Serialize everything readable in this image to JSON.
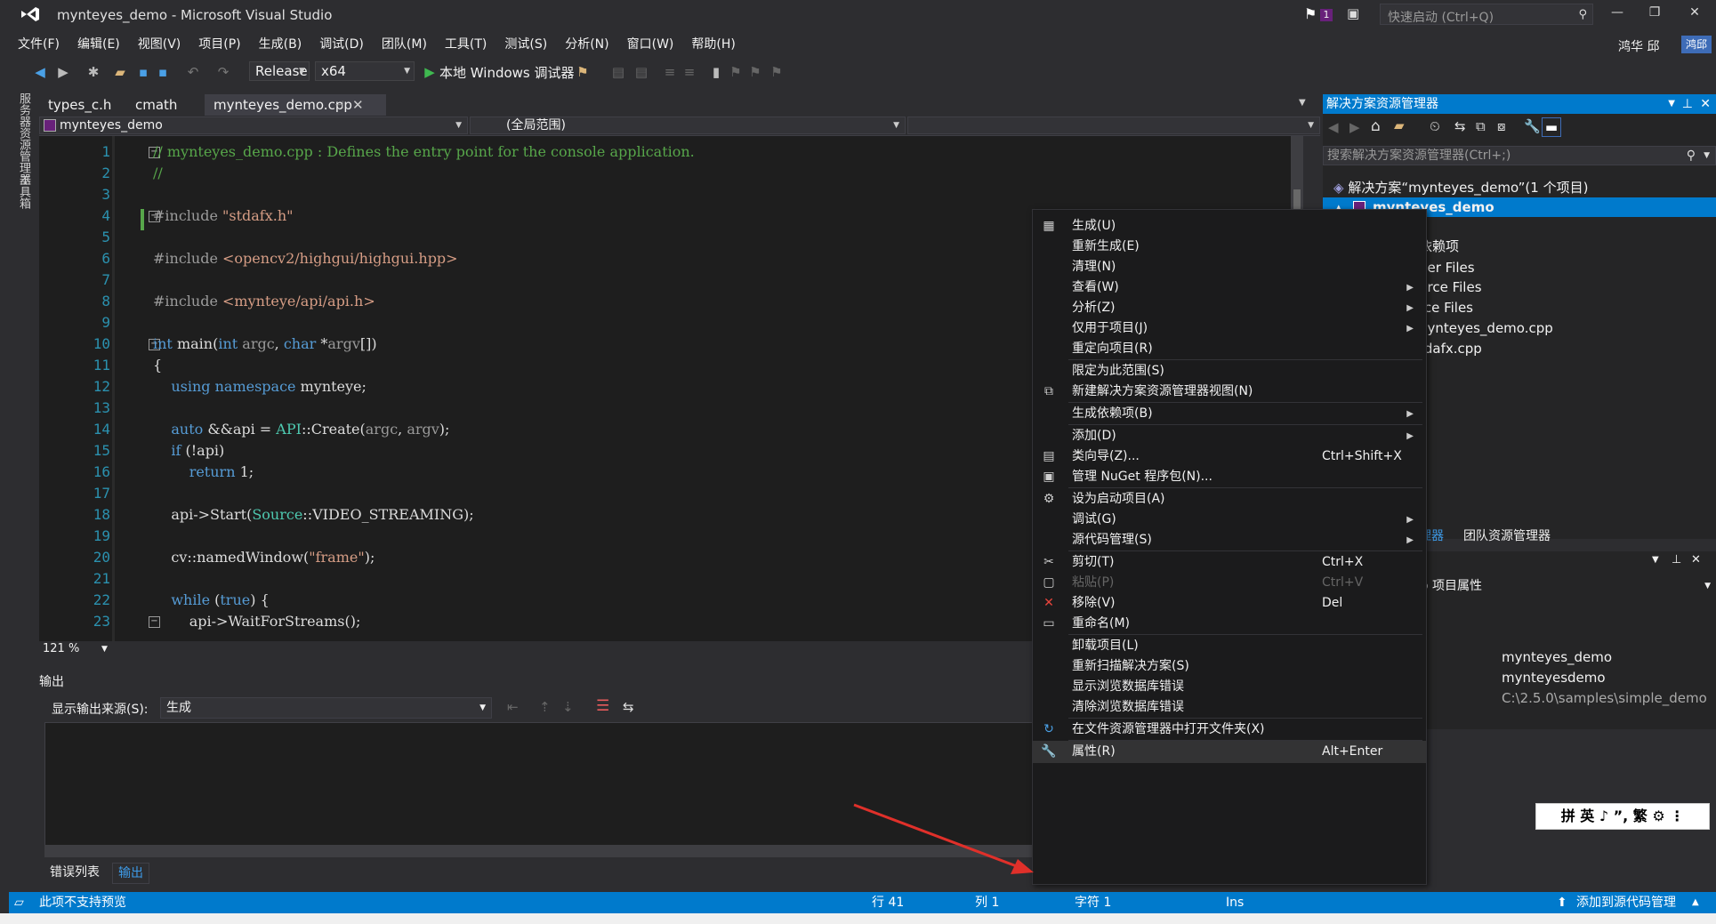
{
  "window": {
    "title": "mynteyes_demo - Microsoft Visual Studio",
    "notification_count": "1",
    "quick_launch_placeholder": "快速启动 (Ctrl+Q)",
    "user_name": "鸿华 邱",
    "user_chip": "鸿邱"
  },
  "menu": [
    "文件(F)",
    "编辑(E)",
    "视图(V)",
    "项目(P)",
    "生成(B)",
    "调试(D)",
    "团队(M)",
    "工具(T)",
    "测试(S)",
    "分析(N)",
    "窗口(W)",
    "帮助(H)"
  ],
  "toolbar": {
    "configuration": "Release",
    "platform": "x64",
    "debugger": "本地 Windows 调试器"
  },
  "left_tabs": [
    "服务器资源管理器",
    "工具箱"
  ],
  "doc_tabs": [
    "types_c.h",
    "cmath",
    "mynteyes_demo.cpp"
  ],
  "navbar": {
    "project": "mynteyes_demo",
    "scope": "(全局范围)"
  },
  "editor": {
    "line_numbers": [
      "1",
      "2",
      "3",
      "4",
      "5",
      "6",
      "7",
      "8",
      "9",
      "10",
      "11",
      "12",
      "13",
      "14",
      "15",
      "16",
      "17",
      "18",
      "19",
      "20",
      "21",
      "22",
      "23"
    ],
    "zoom": "121 %"
  },
  "output": {
    "title": "输出",
    "source_label": "显示输出来源(S):",
    "source_value": "生成",
    "tabs": [
      "错误列表",
      "输出"
    ]
  },
  "solution_explorer": {
    "title": "解决方案资源管理器",
    "search_placeholder": "搜索解决方案资源管理器(Ctrl+;)",
    "solution_label": "解决方案“mynteyes_demo”(1 个项目)",
    "project_label": "mynteyes_demo",
    "items": [
      "依赖项",
      "der Files",
      "urce Files",
      "rce Files",
      "nynteyes_demo.cpp",
      "tdafx.cpp"
    ],
    "bottom_tabs": [
      "理器",
      "团队资源管理器"
    ]
  },
  "properties": {
    "header": "o 项目属性",
    "values": [
      "mynteyes_demo",
      "mynteyesdemo",
      "C:\\2.5.0\\samples\\simple_demo"
    ]
  },
  "ime": "拼 英 ♪ ”, 繁 ⚙ ⋮",
  "context_menu": [
    {
      "label": "生成(U)",
      "shortcut": "",
      "icon": "build-icon",
      "glyph": "▦"
    },
    {
      "label": "重新生成(E)",
      "shortcut": "",
      "icon": "",
      "glyph": ""
    },
    {
      "label": "清理(N)",
      "shortcut": "",
      "icon": "",
      "glyph": ""
    },
    {
      "label": "查看(W)",
      "shortcut": "",
      "icon": "",
      "glyph": "",
      "submenu": true
    },
    {
      "label": "分析(Z)",
      "shortcut": "",
      "icon": "",
      "glyph": "",
      "submenu": true
    },
    {
      "label": "仅用于项目(J)",
      "shortcut": "",
      "icon": "",
      "glyph": "",
      "submenu": true
    },
    {
      "label": "重定向项目(R)",
      "shortcut": "",
      "icon": "",
      "glyph": ""
    },
    {
      "label": "限定为此范围(S)",
      "shortcut": "",
      "icon": "",
      "glyph": ""
    },
    {
      "label": "新建解决方案资源管理器视图(N)",
      "shortcut": "",
      "icon": "new-view-icon",
      "glyph": "⧉"
    },
    {
      "label": "生成依赖项(B)",
      "shortcut": "",
      "icon": "",
      "glyph": "",
      "submenu": true
    },
    {
      "label": "添加(D)",
      "shortcut": "",
      "icon": "",
      "glyph": "",
      "submenu": true
    },
    {
      "label": "类向导(Z)...",
      "shortcut": "Ctrl+Shift+X",
      "icon": "class-wizard-icon",
      "glyph": "▤"
    },
    {
      "label": "管理 NuGet 程序包(N)...",
      "shortcut": "",
      "icon": "nuget-icon",
      "glyph": "▣"
    },
    {
      "label": "设为启动项目(A)",
      "shortcut": "",
      "icon": "gear-icon",
      "glyph": "⚙"
    },
    {
      "label": "调试(G)",
      "shortcut": "",
      "icon": "",
      "glyph": "",
      "submenu": true
    },
    {
      "label": "源代码管理(S)",
      "shortcut": "",
      "icon": "",
      "glyph": "",
      "submenu": true
    },
    {
      "label": "剪切(T)",
      "shortcut": "Ctrl+X",
      "icon": "scissors-icon",
      "glyph": "✂"
    },
    {
      "label": "粘贴(P)",
      "shortcut": "Ctrl+V",
      "icon": "paste-icon",
      "glyph": "▢",
      "disabled": true
    },
    {
      "label": "移除(V)",
      "shortcut": "Del",
      "icon": "delete-x-icon",
      "glyph": "✕"
    },
    {
      "label": "重命名(M)",
      "shortcut": "",
      "icon": "rename-icon",
      "glyph": "▭"
    },
    {
      "label": "卸载项目(L)",
      "shortcut": "",
      "icon": "",
      "glyph": ""
    },
    {
      "label": "重新扫描解决方案(S)",
      "shortcut": "",
      "icon": "",
      "glyph": ""
    },
    {
      "label": "显示浏览数据库错误",
      "shortcut": "",
      "icon": "",
      "glyph": ""
    },
    {
      "label": "清除浏览数据库错误",
      "shortcut": "",
      "icon": "",
      "glyph": ""
    },
    {
      "label": "在文件资源管理器中打开文件夹(X)",
      "shortcut": "",
      "icon": "refresh-arrow-icon",
      "glyph": "↻"
    },
    {
      "label": "属性(R)",
      "shortcut": "Alt+Enter",
      "icon": "wrench-icon",
      "glyph": "🔧"
    }
  ],
  "status_bar": {
    "message": "此项不支持预览",
    "line": "行 41",
    "col": "列 1",
    "char": "字符 1",
    "mode": "Ins",
    "source_control": "添加到源代码管理"
  },
  "colors": {
    "accent": "#007acc",
    "background": "#2d2d30",
    "editor_bg": "#1e1e1e",
    "annotation_arrow": "#e0302a"
  }
}
